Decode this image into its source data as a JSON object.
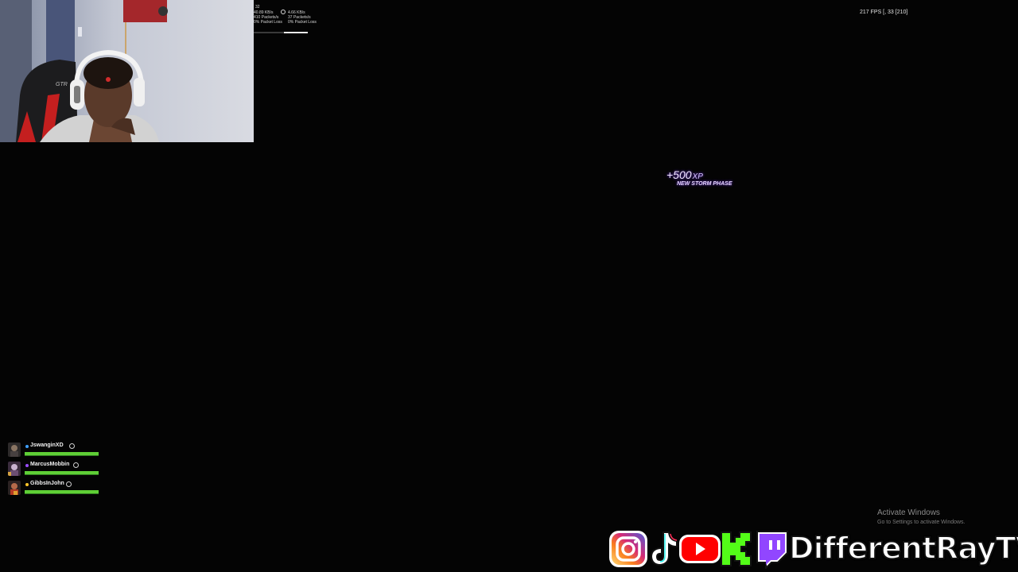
{
  "netstats": {
    "ping": "32",
    "left_rate": "40.89 KB/s",
    "left_packets": "410 Packets/s",
    "left_loss": "0% Packet Loss",
    "right_rate": "4.66 KB/s",
    "right_packets": "37 Packets/s",
    "right_loss": "0% Packet Loss"
  },
  "fps": "217 FPS [, 33 [210]",
  "xp_popup": {
    "amount": "+500",
    "unit": "XP",
    "reason": "NEW STORM PHASE"
  },
  "squad": [
    {
      "name": "JswanginXD",
      "health": 1.0,
      "dot_color": "#3fa0ff"
    },
    {
      "name": "MarcusMobbin",
      "health": 1.0,
      "dot_color": "#9b4dff"
    },
    {
      "name": "GibbsInJohn",
      "health": 1.0,
      "dot_color": "#ffc629"
    }
  ],
  "watermark": {
    "line1": "Activate Windows",
    "line2": "Go to Settings to activate Windows."
  },
  "social": {
    "handle": "DifferentRayTV",
    "icons": [
      "instagram-icon",
      "tiktok-icon",
      "youtube-icon",
      "kick-icon",
      "twitch-icon"
    ],
    "colors": {
      "youtube": "#ff0000",
      "kick": "#53fc18",
      "twitch": "#9146ff"
    }
  }
}
